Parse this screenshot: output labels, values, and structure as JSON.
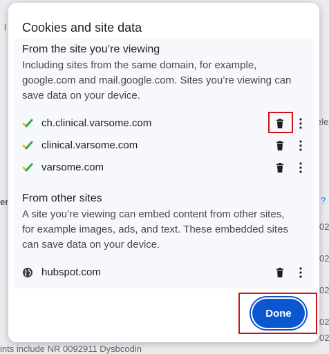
{
  "dialog": {
    "title": "Cookies and site data",
    "section_viewing": {
      "title": "From the site you’re viewing",
      "description": "Including sites from the same domain, for example, google.com and mail.google.com. Sites you’re viewing can save data on your device.",
      "sites": [
        {
          "name": "ch.clinical.varsome.com"
        },
        {
          "name": "clinical.varsome.com"
        },
        {
          "name": "varsome.com"
        }
      ]
    },
    "section_other": {
      "title": "From other sites",
      "description": "A site you’re viewing can embed content from other sites, for example images, ads, and text. These embedded sites can save data on your device.",
      "sites": [
        {
          "name": "hubspot.com"
        }
      ]
    },
    "done_label": "Done"
  },
  "background": {
    "fragment_top_left": "l",
    "fragment_right_1": "ele",
    "fragment_left_1": "en",
    "fragment_right_2": "?",
    "right_fragments": [
      "02",
      "02",
      "02",
      "02",
      "02"
    ],
    "fragment_bottom": "ints include NR 0092911 Dysbcodin"
  },
  "icons": {
    "site_check": "site-check-icon",
    "globe": "globe-icon",
    "trash": "trash-icon",
    "more": "more-vert-icon"
  },
  "colors": {
    "accent": "#0b57d0",
    "highlight": "#d0121b",
    "check_green": "#34a853",
    "check_yellow": "#fbbc04"
  }
}
